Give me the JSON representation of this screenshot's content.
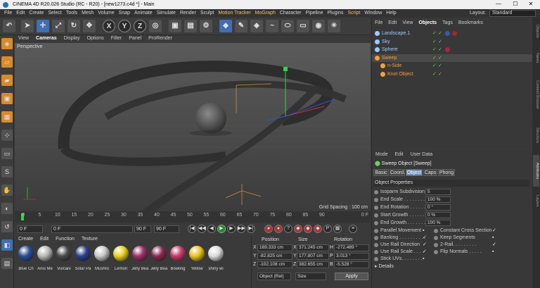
{
  "window": {
    "title": "CINEMA 4D R20.026 Studio (RC - R20) - [new1273.c4d *] - Main",
    "min": "—",
    "max": "☐",
    "close": "✕"
  },
  "menubar": {
    "items": [
      "File",
      "Edit",
      "Create",
      "Select",
      "Tools",
      "Mesh",
      "Volume",
      "Snap",
      "Animate",
      "Simulate",
      "Render",
      "Sculpt",
      "Motion Tracker",
      "MoGraph",
      "Character",
      "Pipeline",
      "Plugins",
      "Script",
      "Window",
      "Help"
    ],
    "highlight": [
      "Motion Tracker",
      "MoGraph",
      "Script"
    ],
    "layout_label": "Layout:",
    "layout_value": "Standard"
  },
  "toolbar": {
    "buttons": [
      "undo-icon",
      "pointer-icon",
      "move-icon",
      "scale-icon",
      "rotate-icon",
      "transform-icon",
      "x-axis",
      "y-axis",
      "z-axis",
      "world-icon",
      "render-view-icon",
      "render-picture-icon",
      "render-settings-icon",
      "cube-icon",
      "pen-icon",
      "subdivision-icon",
      "spline-icon",
      "deformer-icon",
      "floor-icon",
      "camera-icon",
      "light-icon"
    ],
    "axes": [
      "X",
      "Y",
      "Z"
    ]
  },
  "viewport": {
    "menu": [
      "View",
      "Cameras",
      "Display",
      "Options",
      "Filter",
      "Panel",
      "ProRender"
    ],
    "active_menu": "Cameras",
    "label": "Perspective",
    "grid_spacing": "Grid Spacing : 100 cm"
  },
  "timeline": {
    "ticks": [
      "0",
      "5",
      "10",
      "15",
      "20",
      "25",
      "30",
      "35",
      "40",
      "45",
      "50",
      "55",
      "60",
      "65",
      "70",
      "75",
      "80",
      "85",
      "90"
    ],
    "end_frame": "0 F"
  },
  "playback": {
    "current": "0 F",
    "start": "0 F",
    "end": "90 F",
    "end2": "90 F"
  },
  "materials": {
    "menu": [
      "Create",
      "Edit",
      "Function",
      "Texture"
    ],
    "items": [
      {
        "label": "Blue Ch",
        "color": "#2a4e9a"
      },
      {
        "label": "Anis Me",
        "color": "#b8b8b8"
      },
      {
        "label": "Vulcani",
        "color": "#4a4a4a"
      },
      {
        "label": "Solar Pa",
        "color": "#2a3f8a"
      },
      {
        "label": "Mushro",
        "color": "#c8c8c8"
      },
      {
        "label": "Lemon",
        "color": "#e8d21a"
      },
      {
        "label": "Jelly Bea",
        "color": "#a0306a"
      },
      {
        "label": "Jelly Bea",
        "color": "#8a2a50"
      },
      {
        "label": "Bowling",
        "color": "#c83a6a"
      },
      {
        "label": "Yellow",
        "color": "#e8c41a"
      },
      {
        "label": "shiny wi",
        "color": "#dcdcdc"
      }
    ]
  },
  "coordinates": {
    "headers": [
      "Position",
      "Size",
      "Rotation"
    ],
    "rows": [
      {
        "axis": "X",
        "pos": "169.333 cm",
        "size": "371.245 cm",
        "rot_axis": "H",
        "rot": "-272.489 °"
      },
      {
        "axis": "Y",
        "pos": "-82.825 cm",
        "size": "177.807 cm",
        "rot_axis": "P",
        "rot": "3.013 °"
      },
      {
        "axis": "Z",
        "pos": "-102.108 cm",
        "size": "382.655 cm",
        "rot_axis": "B",
        "rot": "-5.528 °"
      }
    ],
    "mode": "Object (Rel)",
    "size_mode": "Size",
    "apply": "Apply"
  },
  "objects": {
    "menu": [
      "File",
      "Edit",
      "View",
      "Objects",
      "Tags",
      "Bookmarks"
    ],
    "active": "Objects",
    "rows": [
      {
        "name": "Landscape.1",
        "color": "#9ecbff",
        "indent": 0,
        "tags": [
          "#3a5aa8",
          "#a02a2a"
        ]
      },
      {
        "name": "Sky",
        "color": "#9ecbff",
        "indent": 0,
        "tags": []
      },
      {
        "name": "Sphere",
        "color": "#9ecbff",
        "indent": 0,
        "tags": [
          "#a02a40"
        ]
      },
      {
        "name": "Sweep",
        "color": "#f2a23c",
        "indent": 0,
        "tags": [],
        "selected": true
      },
      {
        "name": "n-Side",
        "color": "#f2a23c",
        "indent": 1,
        "tags": []
      },
      {
        "name": "Knot Object",
        "color": "#f2a23c",
        "indent": 1,
        "tags": []
      }
    ]
  },
  "attributes": {
    "menu": [
      "Mode",
      "Edit",
      "User Data"
    ],
    "title": "Sweep Object [Sweep]",
    "tabs": [
      "Basic",
      "Coord.",
      "Object",
      "Caps",
      "Phong"
    ],
    "active_tab": "Object",
    "section": "Object Properties",
    "props": [
      {
        "label": "Isoparm Subdivision",
        "value": "5"
      },
      {
        "label": "End Scale . . . . . . . . .",
        "value": "100 %"
      },
      {
        "label": "End Rotation . . . . . . .",
        "value": "0 °"
      },
      {
        "label": "Start Growth . . . . . . .",
        "value": "0 %"
      },
      {
        "label": "End Growth . . . . . . . .",
        "value": "100 %"
      }
    ],
    "checks_left": [
      {
        "label": "Parallel Movement",
        "checked": false
      },
      {
        "label": "Banking . . . . . . . . . .",
        "checked": true
      },
      {
        "label": "Use Rail Direction",
        "checked": true
      },
      {
        "label": "Use Rail Scale . . . .",
        "checked": true
      },
      {
        "label": "Stick UVs. . . . . . . .",
        "checked": false
      }
    ],
    "checks_right": [
      {
        "label": "Constant Cross Section",
        "checked": true
      },
      {
        "label": "Keep Segments",
        "checked": false
      },
      {
        "label": "2-Rail. . . . . . . . .",
        "checked": true
      },
      {
        "label": "Flip Normals . . . . .",
        "checked": false
      }
    ],
    "details": "▸ Details"
  },
  "sidetabs": [
    "Objects",
    "Takes",
    "Content Browser",
    "Structure",
    "Attributes",
    "Layers"
  ]
}
